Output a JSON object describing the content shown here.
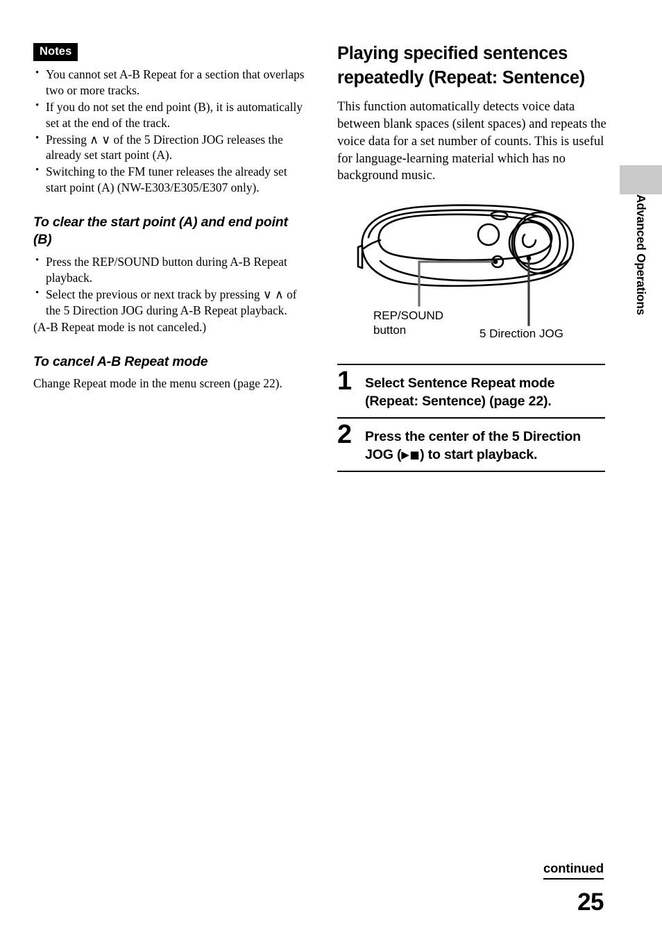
{
  "left_column": {
    "notes_badge": "Notes",
    "notes_items": [
      "You cannot set A-B Repeat for a section that overlaps two or more tracks.",
      "If you do not set the end point (B), it is automatically set at the end of the track.",
      "Pressing ∧ ∨ of the 5 Direction JOG releases the already set start point (A).",
      "Switching to the FM tuner releases the already set start point (A) (NW-E303/E305/E307 only)."
    ],
    "clear_points_heading": "To clear the start point (A) and end point (B)",
    "clear_points_items": [
      "Press the REP/SOUND button during A-B Repeat playback.",
      "Select the previous or next track by pressing ∨ ∧ of the 5 Direction JOG during A-B Repeat playback."
    ],
    "clear_points_note": "(A-B Repeat mode is not canceled.)",
    "cancel_heading": "To cancel A-B Repeat mode",
    "cancel_body": "Change Repeat mode in the menu screen (page 22)."
  },
  "right_column": {
    "title": "Playing specified sentences repeatedly (Repeat: Sentence)",
    "intro": "This function automatically detects voice data between blank spaces (silent spaces) and repeats the voice data for a set number of counts. This is useful for language-learning material which has no background music.",
    "illustration": {
      "label_rep_sound": "REP/SOUND\nbutton",
      "label_jog": "5 Direction JOG"
    },
    "steps": [
      {
        "number": "1",
        "text": "Select Sentence Repeat mode (Repeat: Sentence) (page 22)."
      },
      {
        "number": "2",
        "text_before": "Press the center of the 5 Direction JOG (",
        "glyphs": "▶■",
        "text_after": ") to start playback."
      }
    ]
  },
  "side_tab": {
    "label": "Advanced Operations",
    "block_color": "#c9c9c9"
  },
  "footer": {
    "continued": "continued",
    "page_number": "25"
  }
}
